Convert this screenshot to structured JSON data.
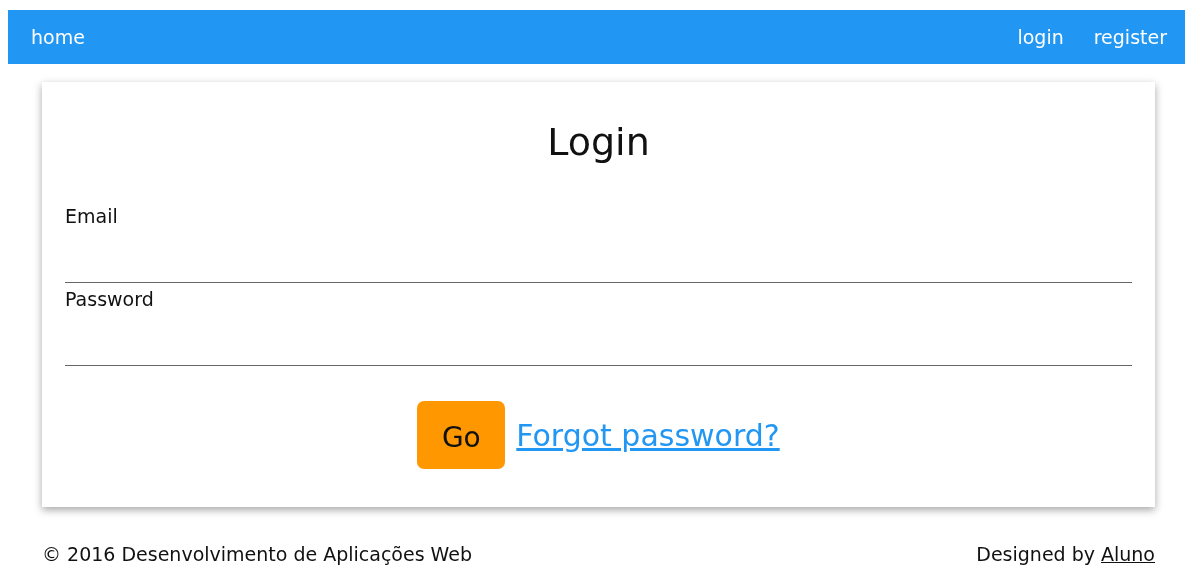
{
  "nav": {
    "home": "home",
    "links": [
      "login",
      "register"
    ]
  },
  "card": {
    "title": "Login",
    "fields": [
      {
        "label": "Email"
      },
      {
        "label": "Password"
      }
    ],
    "submit": "Go",
    "forgot_link": "Forgot password?"
  },
  "footer": {
    "copyright": "© 2016 Desenvolvimento de Aplicações Web",
    "designed_by": "Designed by",
    "author_link": "Aluno"
  }
}
